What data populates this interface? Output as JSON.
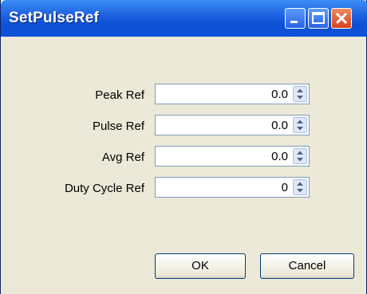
{
  "window": {
    "title": "SetPulseRef"
  },
  "fields": [
    {
      "label": "Peak Ref",
      "value": "0.0"
    },
    {
      "label": "Pulse Ref",
      "value": "0.0"
    },
    {
      "label": "Avg Ref",
      "value": "0.0"
    },
    {
      "label": "Duty Cycle Ref",
      "value": "0"
    }
  ],
  "buttons": {
    "ok": "OK",
    "cancel": "Cancel"
  },
  "icons": {
    "minimize": "minimize-icon",
    "maximize": "maximize-icon",
    "close": "close-icon",
    "spinner": "spinner-updown-icon"
  },
  "colors": {
    "title_bar": "#1f63e0",
    "dialog_face": "#ECE9D8",
    "button_border": "#003c74"
  }
}
